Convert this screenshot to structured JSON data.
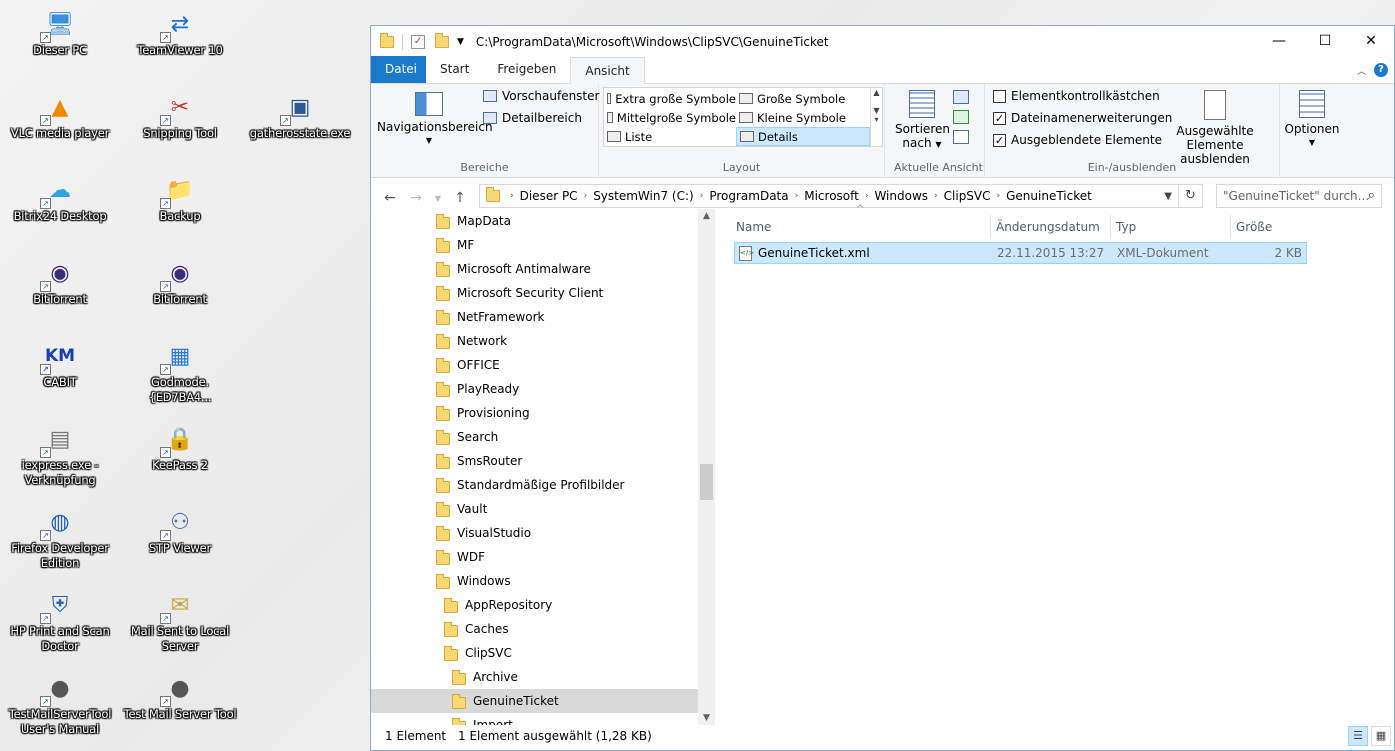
{
  "desktop": {
    "icons": [
      {
        "label": "Dieser PC",
        "icon": "computer-icon",
        "glyph": "🖥"
      },
      {
        "label": "TeamViewer 10",
        "icon": "teamviewer-icon",
        "glyph": "⇄"
      },
      {
        "label": "VLC media player",
        "icon": "vlc-icon",
        "glyph": "▲"
      },
      {
        "label": "Snipping Tool",
        "icon": "scissors-icon",
        "glyph": "✂"
      },
      {
        "label": "gatherosstate.exe",
        "icon": "exe-icon",
        "glyph": "▣"
      },
      {
        "label": "Bitrix24 Desktop",
        "icon": "bitrix-icon",
        "glyph": "☁"
      },
      {
        "label": "Backup",
        "icon": "folder-icon",
        "glyph": "📁"
      },
      {
        "label": "BitTorrent",
        "icon": "bittorrent-icon",
        "glyph": "◉"
      },
      {
        "label": "BitTorrent",
        "icon": "bittorrent-icon",
        "glyph": "◉"
      },
      {
        "label": "CABIT",
        "icon": "km-icon",
        "glyph": "KM"
      },
      {
        "label": "Godmode.{ED7BA4...",
        "icon": "control-panel-icon",
        "glyph": "▦"
      },
      {
        "label": "iexpress.exe - Verknüpfung",
        "icon": "installer-icon",
        "glyph": "▤"
      },
      {
        "label": "KeePass 2",
        "icon": "keepass-icon",
        "glyph": "🔒"
      },
      {
        "label": "Firefox Developer Edition",
        "icon": "firefox-icon",
        "glyph": "◍"
      },
      {
        "label": "STP Viewer",
        "icon": "network-icon",
        "glyph": "⚇"
      },
      {
        "label": "HP Print and Scan Doctor",
        "icon": "hp-doctor-icon",
        "glyph": "⛨"
      },
      {
        "label": "Mail Sent to Local Server",
        "icon": "mail-folder-icon",
        "glyph": "✉"
      },
      {
        "label": "TestMailServerTool User's Manual",
        "icon": "mailtool-icon",
        "glyph": "●"
      },
      {
        "label": "Test Mail Server Tool",
        "icon": "mailtool-icon",
        "glyph": "●"
      }
    ]
  },
  "window": {
    "title": "C:\\ProgramData\\Microsoft\\Windows\\ClipSVC\\GenuineTicket",
    "controls": {
      "minimize": "—",
      "maximize": "☐",
      "close": "✕"
    }
  },
  "ribbon": {
    "tabs": [
      "Datei",
      "Start",
      "Freigeben",
      "Ansicht"
    ],
    "active_tab": "Ansicht",
    "help": "?",
    "groups": {
      "bereiche": {
        "label": "Bereiche",
        "nav_pane": "Navigationsbereich",
        "preview": "Vorschaufenster",
        "details": "Detailbereich"
      },
      "layout": {
        "label": "Layout",
        "items": [
          "Extra große Symbole",
          "Große Symbole",
          "Mittelgroße Symbole",
          "Kleine Symbole",
          "Liste",
          "Details"
        ],
        "selected": "Details"
      },
      "view": {
        "label": "Aktuelle Ansicht",
        "sort": "Sortieren",
        "sort2": "nach"
      },
      "showhide": {
        "label": "Ein-/ausblenden",
        "checkboxes": [
          {
            "label": "Elementkontrollkästchen",
            "checked": false
          },
          {
            "label": "Dateinamenerweiterungen",
            "checked": true
          },
          {
            "label": "Ausgeblendete Elemente",
            "checked": true
          }
        ],
        "hide_selected": "Ausgewählte",
        "hide_selected2": "Elemente ausblenden"
      },
      "options": {
        "label": "Optionen"
      }
    }
  },
  "address": {
    "crumbs": [
      "Dieser PC",
      "SystemWin7 (C:)",
      "ProgramData",
      "Microsoft",
      "Windows",
      "ClipSVC",
      "GenuineTicket"
    ],
    "search_placeholder": "\"GenuineTicket\" durch..."
  },
  "tree": [
    {
      "label": "MapData",
      "level": 0
    },
    {
      "label": "MF",
      "level": 0
    },
    {
      "label": "Microsoft Antimalware",
      "level": 0
    },
    {
      "label": "Microsoft Security Client",
      "level": 0
    },
    {
      "label": "NetFramework",
      "level": 0
    },
    {
      "label": "Network",
      "level": 0
    },
    {
      "label": "OFFICE",
      "level": 0
    },
    {
      "label": "PlayReady",
      "level": 0
    },
    {
      "label": "Provisioning",
      "level": 0
    },
    {
      "label": "Search",
      "level": 0
    },
    {
      "label": "SmsRouter",
      "level": 0
    },
    {
      "label": "Standardmäßige Profilbilder",
      "level": 0
    },
    {
      "label": "Vault",
      "level": 0
    },
    {
      "label": "VisualStudio",
      "level": 0
    },
    {
      "label": "WDF",
      "level": 0
    },
    {
      "label": "Windows",
      "level": 0
    },
    {
      "label": "AppRepository",
      "level": 1
    },
    {
      "label": "Caches",
      "level": 1
    },
    {
      "label": "ClipSVC",
      "level": 1
    },
    {
      "label": "Archive",
      "level": 2
    },
    {
      "label": "GenuineTicket",
      "level": 2,
      "selected": true
    },
    {
      "label": "Import",
      "level": 2
    }
  ],
  "columns": [
    "Name",
    "Änderungsdatum",
    "Typ",
    "Größe"
  ],
  "files": [
    {
      "name": "GenuineTicket.xml",
      "modified": "22.11.2015 13:27",
      "type": "XML-Dokument",
      "size": "2 KB"
    }
  ],
  "status": {
    "count": "1 Element",
    "selected": "1 Element ausgewählt (1,28 KB)"
  }
}
